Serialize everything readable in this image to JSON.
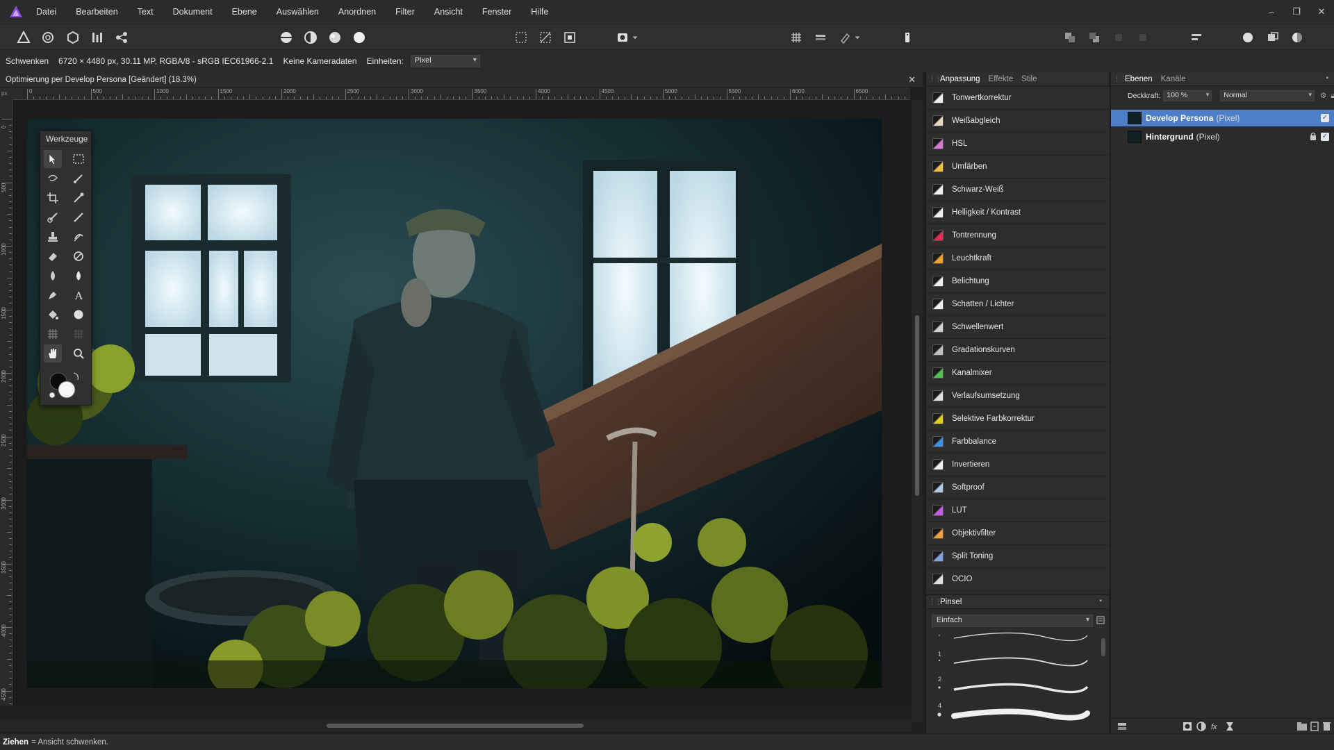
{
  "menubar": {
    "items": [
      "Datei",
      "Bearbeiten",
      "Text",
      "Dokument",
      "Ebene",
      "Auswählen",
      "Anordnen",
      "Filter",
      "Ansicht",
      "Fenster",
      "Hilfe"
    ],
    "minimize": "–",
    "restore": "❐",
    "close": "✕"
  },
  "context": {
    "tool": "Schwenken",
    "doc_info": "6720 × 4480 px, 30.11 MP, RGBA/8 - sRGB IEC61966-2.1",
    "camera": "Keine Kameradaten",
    "units_label": "Einheiten:",
    "units_value": "Pixel"
  },
  "document": {
    "title": "Optimierung per Develop Persona [Geändert] (18.3%)",
    "close": "✕",
    "ruler_unit": "px",
    "ruler_h_labels": [
      "0",
      "500",
      "1000",
      "1500",
      "2000",
      "2500",
      "3000",
      "3500",
      "4000",
      "4500",
      "5000",
      "5500",
      "6000",
      "6500"
    ],
    "ruler_v_labels": [
      "0",
      "500",
      "1000",
      "1500",
      "2000",
      "2500",
      "3000",
      "3500",
      "4000",
      "4500"
    ]
  },
  "tools_panel": {
    "title": "Werkzeuge"
  },
  "adjustments": {
    "tabs": [
      "Anpassung",
      "Effekte",
      "Stile"
    ],
    "items": [
      {
        "label": "Tonwertkorrektur",
        "icon": "levels-icon",
        "color": "#eeeeee"
      },
      {
        "label": "Weißabgleich",
        "icon": "white-balance-icon",
        "color": "#e8d8c0"
      },
      {
        "label": "HSL",
        "icon": "hsl-icon",
        "color": "#d67bd6"
      },
      {
        "label": "Umfärben",
        "icon": "recolor-icon",
        "color": "#f0c040"
      },
      {
        "label": "Schwarz-Weiß",
        "icon": "black-white-icon",
        "color": "#f0f0f0"
      },
      {
        "label": "Helligkeit / Kontrast",
        "icon": "brightness-contrast-icon",
        "color": "#f0f0f0"
      },
      {
        "label": "Tontrennung",
        "icon": "posterize-icon",
        "color": "#e03050"
      },
      {
        "label": "Leuchtkraft",
        "icon": "vibrance-icon",
        "color": "#f0a030"
      },
      {
        "label": "Belichtung",
        "icon": "exposure-icon",
        "color": "#f0f0f0"
      },
      {
        "label": "Schatten / Lichter",
        "icon": "shadows-highlights-icon",
        "color": "#f0f0f0"
      },
      {
        "label": "Schwellenwert",
        "icon": "threshold-icon",
        "color": "#d0d0d0"
      },
      {
        "label": "Gradationskurven",
        "icon": "curves-icon",
        "color": "#c0c0c0"
      },
      {
        "label": "Kanalmixer",
        "icon": "channel-mixer-icon",
        "color": "#50c050"
      },
      {
        "label": "Verlaufsumsetzung",
        "icon": "gradient-map-icon",
        "color": "#e0e0e0"
      },
      {
        "label": "Selektive Farbkorrektur",
        "icon": "selective-color-icon",
        "color": "#e0d020"
      },
      {
        "label": "Farbbalance",
        "icon": "color-balance-icon",
        "color": "#4090e0"
      },
      {
        "label": "Invertieren",
        "icon": "invert-icon",
        "color": "#f0f0f0"
      },
      {
        "label": "Softproof",
        "icon": "soft-proof-icon",
        "color": "#b0c8e0"
      },
      {
        "label": "LUT",
        "icon": "lut-icon",
        "color": "#c060e0"
      },
      {
        "label": "Objektivfilter",
        "icon": "lens-filter-icon",
        "color": "#f0a040"
      },
      {
        "label": "Split Toning",
        "icon": "split-toning-icon",
        "color": "#80a0e0"
      },
      {
        "label": "OCIO",
        "icon": "ocio-icon",
        "color": "#e0e0e0"
      }
    ]
  },
  "brushes": {
    "tab": "Pinsel",
    "category": "Einfach",
    "sizes": [
      "1",
      "2",
      "4"
    ]
  },
  "layers": {
    "tabs": [
      "Ebenen",
      "Kanäle"
    ],
    "opacity_label": "Deckkraft:",
    "opacity_value": "100 %",
    "blend_mode": "Normal",
    "items": [
      {
        "name": "Develop Persona",
        "type": "(Pixel)",
        "selected": true
      },
      {
        "name": "Hintergrund",
        "type": "(Pixel)",
        "selected": false
      }
    ]
  },
  "status": {
    "key": "Ziehen",
    "text": "= Ansicht schwenken."
  }
}
